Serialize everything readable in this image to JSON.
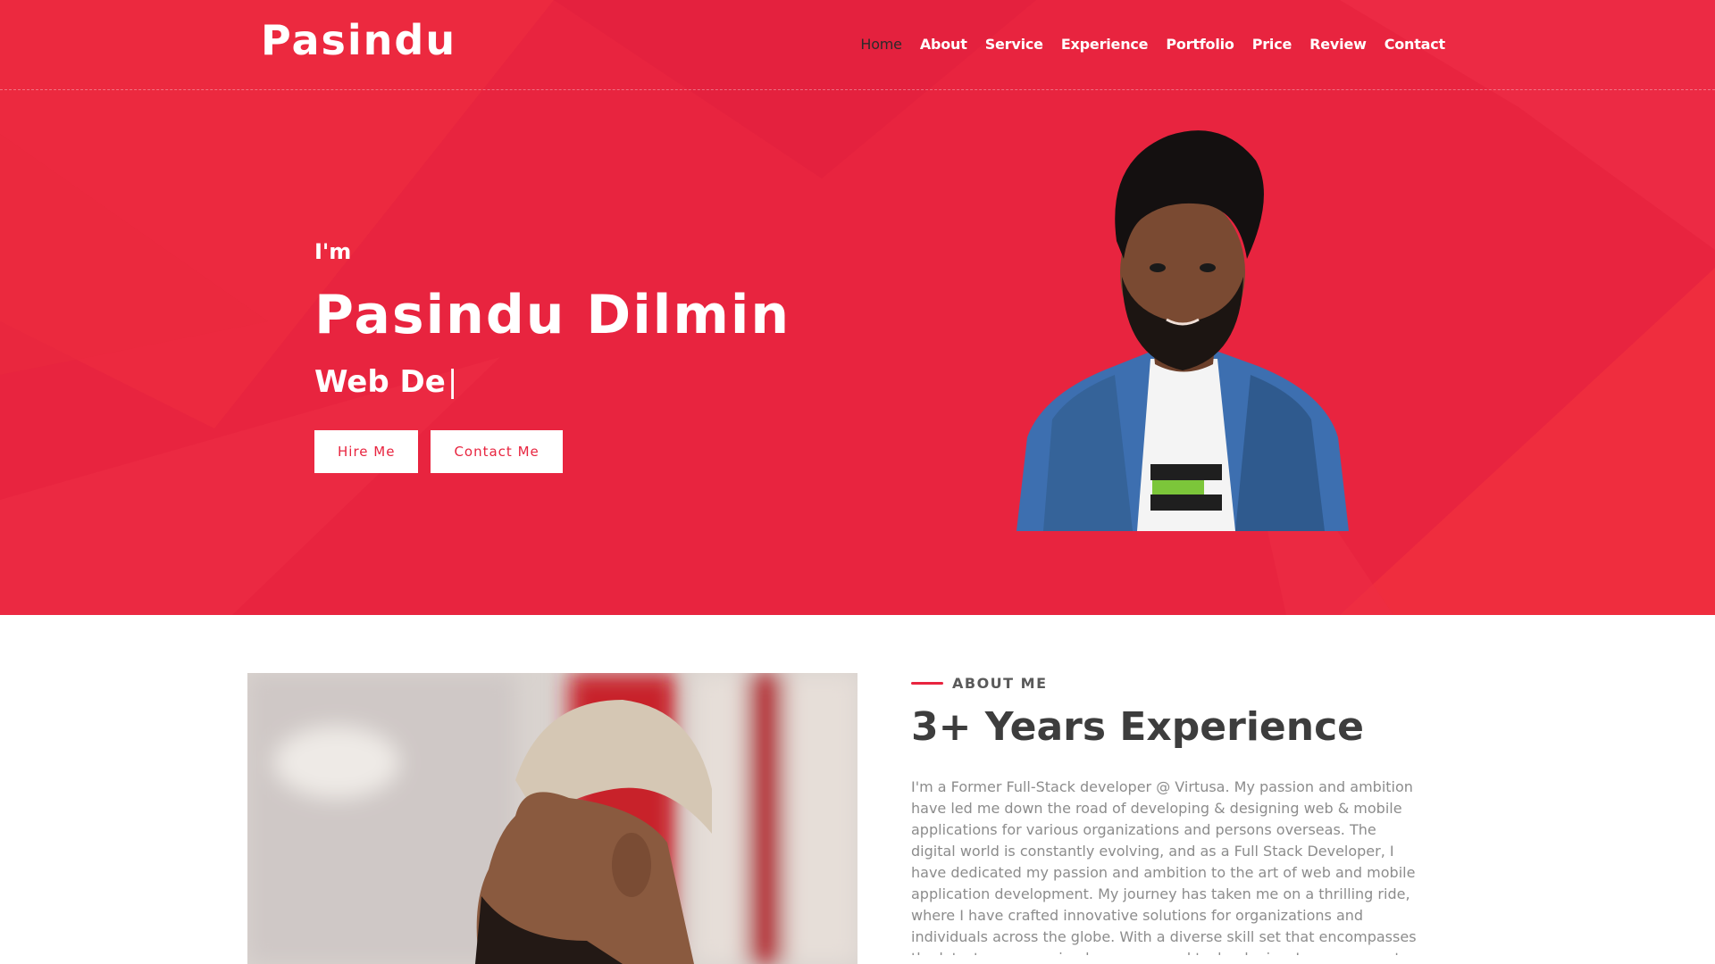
{
  "brand": {
    "logo": "Pasindu",
    "accent": "#e8243f"
  },
  "nav": {
    "items": [
      "Home",
      "About",
      "Service",
      "Experience",
      "Portfolio",
      "Price",
      "Review",
      "Contact"
    ],
    "active": "Home"
  },
  "hero": {
    "greeting": "I'm",
    "name": "Pasindu Dilmin",
    "role_typed": "Web De",
    "cursor": "|",
    "buttons": {
      "hire": "Hire Me",
      "contact": "Contact Me"
    }
  },
  "about": {
    "eyebrow": "ABOUT ME",
    "title": "3+ Years Experience",
    "paragraph": "I'm a Former Full-Stack developer @ Virtusa. My passion and ambition have led me down the road of developing & designing web & mobile applications for various organizations and persons overseas. The digital world is constantly evolving, and as a Full Stack Developer, I have dedicated my passion and ambition to the art of web and mobile application development. My journey has taken me on a thrilling ride, where I have crafted innovative solutions for organizations and individuals across the globe. With a diverse skill set that encompasses the latest programming languages and technologies, I am an expert"
  }
}
